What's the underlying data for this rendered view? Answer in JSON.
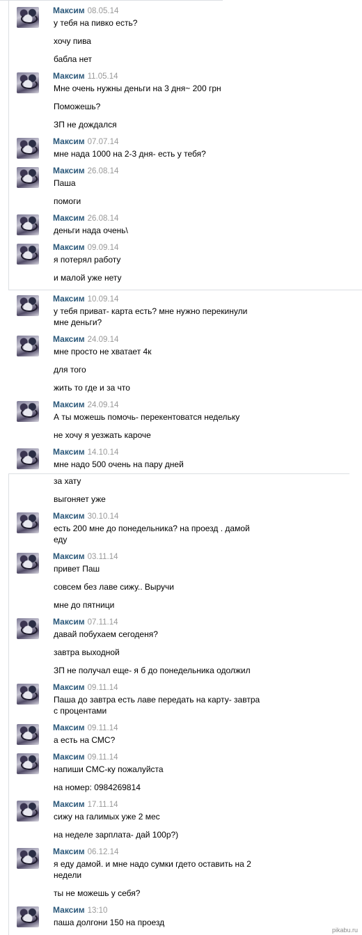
{
  "messages": [
    {
      "author": "Максим",
      "date": "08.05.14",
      "lines": [
        "у тебя на пивко есть?",
        "хочу пива",
        "бабла нет"
      ]
    },
    {
      "author": "Максим",
      "date": "11.05.14",
      "lines": [
        "Мне очень нужны деньги на 3 дня~ 200 грн",
        "Поможешь?",
        "ЗП не дождался"
      ]
    },
    {
      "author": "Максим",
      "date": "07.07.14",
      "lines": [
        "мне нада 1000 на 2-3 дня- есть у тебя?"
      ]
    },
    {
      "author": "Максим",
      "date": "26.08.14",
      "lines": [
        "Паша",
        "помоги"
      ]
    },
    {
      "author": "Максим",
      "date": "26.08.14",
      "lines": [
        "деньги нада очень\\"
      ]
    },
    {
      "author": "Максим",
      "date": "09.09.14",
      "lines": [
        "я потерял работу",
        "и малой уже нету"
      ]
    },
    {
      "author": "Максим",
      "date": "10.09.14",
      "lines": [
        "у тебя приват- карта есть? мне нужно перекинули",
        "мне деньги?"
      ]
    },
    {
      "author": "Максим",
      "date": "24.09.14",
      "lines": [
        "мне просто не хватает 4к",
        "для того",
        "жить то где и за что"
      ]
    },
    {
      "author": "Максим",
      "date": "24.09.14",
      "lines": [
        "А ты можешь помочь- перекентоватся недельку",
        "не хочу я уезжать кароче"
      ]
    },
    {
      "author": "Максим",
      "date": "14.10.14",
      "lines": [
        "мне надо 500 очень на пару дней",
        "за хату",
        "выгоняет уже"
      ]
    },
    {
      "author": "Максим",
      "date": "30.10.14",
      "lines": [
        "есть 200 мне до понедельника? на проезд . дамой",
        "еду"
      ]
    },
    {
      "author": "Максим",
      "date": "03.11.14",
      "lines": [
        "привет Паш",
        "совсем без лаве сижу.. Выручи",
        "мне до пятници"
      ]
    },
    {
      "author": "Максим",
      "date": "07.11.14",
      "lines": [
        "давай побухаем сегоденя?",
        "завтра выходной",
        "ЗП не получал еще- я б до понедельника одолжил"
      ]
    },
    {
      "author": "Максим",
      "date": "09.11.14",
      "lines": [
        "Паша до завтра есть лаве передать на карту- завтра",
        "с процентами"
      ]
    },
    {
      "author": "Максим",
      "date": "09.11.14",
      "lines": [
        "а есть на СМС?"
      ]
    },
    {
      "author": "Максим",
      "date": "09.11.14",
      "lines": [
        "напиши СМС-ку пожалуйста",
        "на номер: 0984269814"
      ]
    },
    {
      "author": "Максим",
      "date": "17.11.14",
      "lines": [
        "сижу на галимых уже 2 мес",
        "на неделе зарплата- дай 100р?)"
      ]
    },
    {
      "author": "Максим",
      "date": "06.12.14",
      "lines": [
        "я еду дамой. и мне надо сумки гдето оставить на 2",
        "недели",
        "ты не можешь у себя?"
      ]
    },
    {
      "author": "Максим",
      "date": "13:10",
      "lines": [
        "паша долгони 150 на проезд"
      ]
    }
  ],
  "watermark": "pikabu.ru"
}
